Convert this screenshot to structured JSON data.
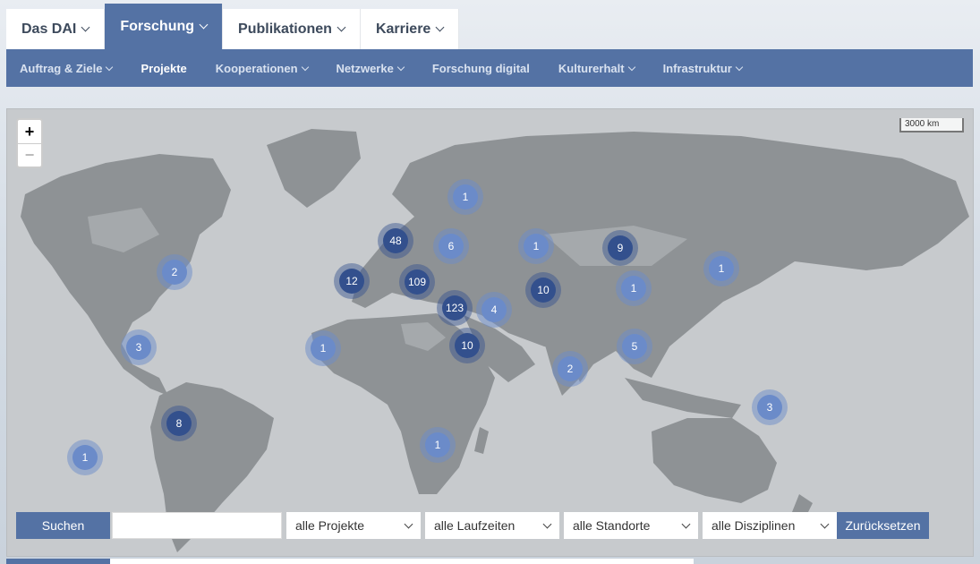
{
  "top_nav": [
    {
      "label": "Das DAI",
      "active": false
    },
    {
      "label": "Forschung",
      "active": true
    },
    {
      "label": "Publikationen",
      "active": false
    },
    {
      "label": "Karriere",
      "active": false
    }
  ],
  "sub_nav": [
    {
      "label": "Auftrag & Ziele",
      "dropdown": true,
      "active": false
    },
    {
      "label": "Projekte",
      "dropdown": false,
      "active": true
    },
    {
      "label": "Kooperationen",
      "dropdown": true,
      "active": false
    },
    {
      "label": "Netzwerke",
      "dropdown": true,
      "active": false
    },
    {
      "label": "Forschung digital",
      "dropdown": false,
      "active": false
    },
    {
      "label": "Kulturerhalt",
      "dropdown": true,
      "active": false
    },
    {
      "label": "Infrastruktur",
      "dropdown": true,
      "active": false
    }
  ],
  "map": {
    "zoom_in": "+",
    "zoom_out": "−",
    "scale_label": "3000 km",
    "clusters": [
      {
        "count": "1",
        "location": "Scandinavia / Russia north"
      },
      {
        "count": "48",
        "location": "Central Europe"
      },
      {
        "count": "6",
        "location": "Eastern Europe"
      },
      {
        "count": "1",
        "location": "Central Asia"
      },
      {
        "count": "9",
        "location": "Mongolia"
      },
      {
        "count": "2",
        "location": "Eastern USA"
      },
      {
        "count": "12",
        "location": "Iberia"
      },
      {
        "count": "109",
        "location": "Mediterranean"
      },
      {
        "count": "1",
        "location": "Japan"
      },
      {
        "count": "123",
        "location": "Eastern Mediterranean"
      },
      {
        "count": "4",
        "location": "Arabia"
      },
      {
        "count": "10",
        "location": "Pakistan"
      },
      {
        "count": "1",
        "location": "China"
      },
      {
        "count": "3",
        "location": "Central America"
      },
      {
        "count": "1",
        "location": "West Africa"
      },
      {
        "count": "10",
        "location": "Sudan"
      },
      {
        "count": "5",
        "location": "Southeast Asia"
      },
      {
        "count": "2",
        "location": "India"
      },
      {
        "count": "3",
        "location": "Melanesia"
      },
      {
        "count": "8",
        "location": "Peru"
      },
      {
        "count": "1",
        "location": "Southern Africa"
      },
      {
        "count": "1",
        "location": "Pacific"
      }
    ]
  },
  "filters": {
    "search_button": "Suchen",
    "search_value": "",
    "projects": "alle Projekte",
    "durations": "alle Laufzeiten",
    "locations": "alle Standorte",
    "disciplines": "alle Disziplinen",
    "reset_button": "Zurücksetzen"
  },
  "colors": {
    "accent": "#5472a4",
    "cluster_light": "#6b8bc9",
    "cluster_dark": "#33508d",
    "map_water": "#c7cacd",
    "map_land": "#8f9396"
  }
}
